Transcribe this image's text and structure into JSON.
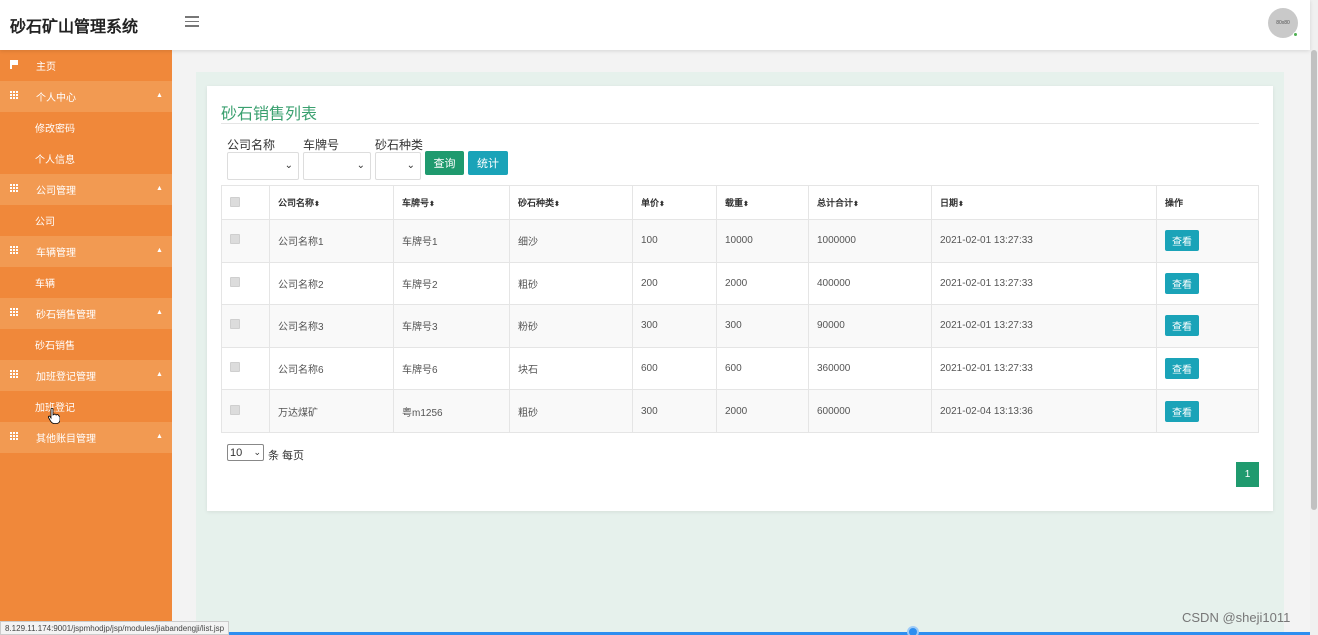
{
  "header": {
    "app_title": "砂石矿山管理系统",
    "avatar_text": "80x80"
  },
  "sidebar": {
    "items": [
      {
        "label": "主页",
        "type": "top",
        "icon": "flag-icon"
      },
      {
        "label": "个人中心",
        "type": "group",
        "icon": "grid-icon"
      },
      {
        "label": "修改密码",
        "type": "child"
      },
      {
        "label": "个人信息",
        "type": "child"
      },
      {
        "label": "公司管理",
        "type": "group",
        "icon": "grid-icon"
      },
      {
        "label": "公司",
        "type": "child"
      },
      {
        "label": "车辆管理",
        "type": "group",
        "icon": "grid-icon"
      },
      {
        "label": "车辆",
        "type": "child"
      },
      {
        "label": "砂石销售管理",
        "type": "group",
        "icon": "grid-icon"
      },
      {
        "label": "砂石销售",
        "type": "child"
      },
      {
        "label": "加班登记管理",
        "type": "group",
        "icon": "grid-icon"
      },
      {
        "label": "加班登记",
        "type": "child"
      },
      {
        "label": "其他账目管理",
        "type": "group",
        "icon": "grid-icon"
      }
    ],
    "caret": "▲"
  },
  "main": {
    "title": "砂石销售列表",
    "filters": {
      "company_label": "公司名称",
      "plate_label": "车牌号",
      "type_label": "砂石种类",
      "search_button": "查询",
      "stats_button": "统计"
    },
    "table": {
      "columns": [
        "公司名称",
        "车牌号",
        "砂石种类",
        "单价",
        "载重",
        "总计合计",
        "日期",
        "操作"
      ],
      "sort_glyph": "⬍",
      "rows": [
        {
          "company": "公司名称1",
          "plate": "车牌号1",
          "type": "细沙",
          "price": "100",
          "load": "10000",
          "total": "1000000",
          "date": "2021-02-01 13:27:33"
        },
        {
          "company": "公司名称2",
          "plate": "车牌号2",
          "type": "粗砂",
          "price": "200",
          "load": "2000",
          "total": "400000",
          "date": "2021-02-01 13:27:33"
        },
        {
          "company": "公司名称3",
          "plate": "车牌号3",
          "type": "粉砂",
          "price": "300",
          "load": "300",
          "total": "90000",
          "date": "2021-02-01 13:27:33"
        },
        {
          "company": "公司名称6",
          "plate": "车牌号6",
          "type": "块石",
          "price": "600",
          "load": "600",
          "total": "360000",
          "date": "2021-02-01 13:27:33"
        },
        {
          "company": "万达煤矿",
          "plate": "粤m1256",
          "type": "粗砂",
          "price": "300",
          "load": "2000",
          "total": "600000",
          "date": "2021-02-04 13:13:36"
        }
      ],
      "view_button": "查看"
    },
    "pagination": {
      "page_size": "10",
      "page_size_suffix": "条 每页",
      "current_page": "1"
    }
  },
  "status": {
    "url": "8.129.11.174:9001/jspmhodjp/jsp/modules/jiabandengji/list.jsp"
  },
  "watermark": "CSDN @sheji1011",
  "colors": {
    "sidebar": "#f0883a",
    "accent_green": "#1f9a6e",
    "accent_teal": "#1aa3b8",
    "title_green": "#3aa06f"
  }
}
